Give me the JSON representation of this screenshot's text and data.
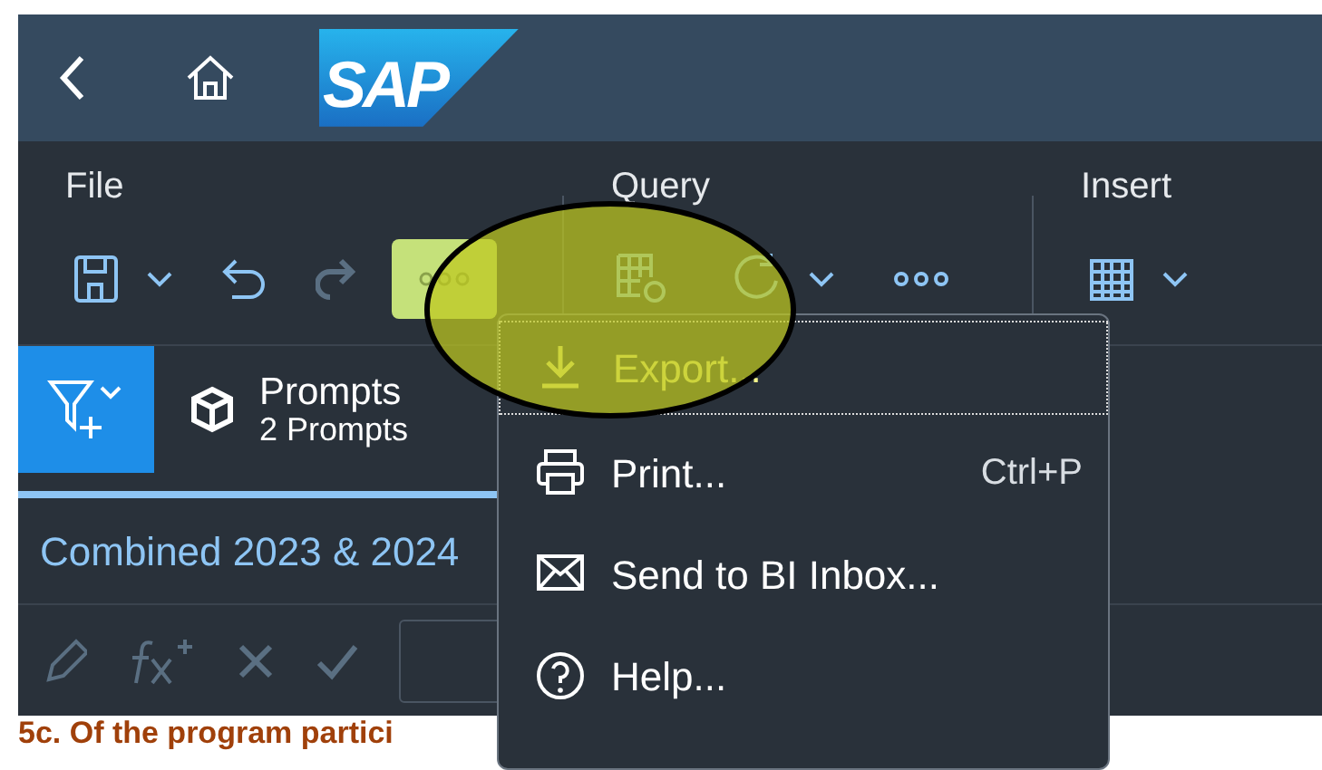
{
  "header": {
    "logo": "SAP"
  },
  "toolbar": {
    "groups": [
      {
        "label": "File"
      },
      {
        "label": "Query"
      },
      {
        "label": "Insert"
      }
    ],
    "more_selected": true
  },
  "prompts": {
    "title": "Prompts",
    "count": "2 Prompts"
  },
  "document_tab": {
    "title": "Combined 2023 & 2024"
  },
  "report_text": "5c.  Of the program partici",
  "menu": {
    "items": [
      {
        "kind": "export",
        "label": "Export...",
        "selected": true
      },
      {
        "kind": "print",
        "label": "Print...",
        "shortcut": "Ctrl+P",
        "selected": false
      },
      {
        "kind": "mail",
        "label": "Send to BI Inbox...",
        "selected": false
      },
      {
        "kind": "help",
        "label": "Help...",
        "selected": false
      }
    ]
  },
  "annotation": {
    "shown": true
  }
}
